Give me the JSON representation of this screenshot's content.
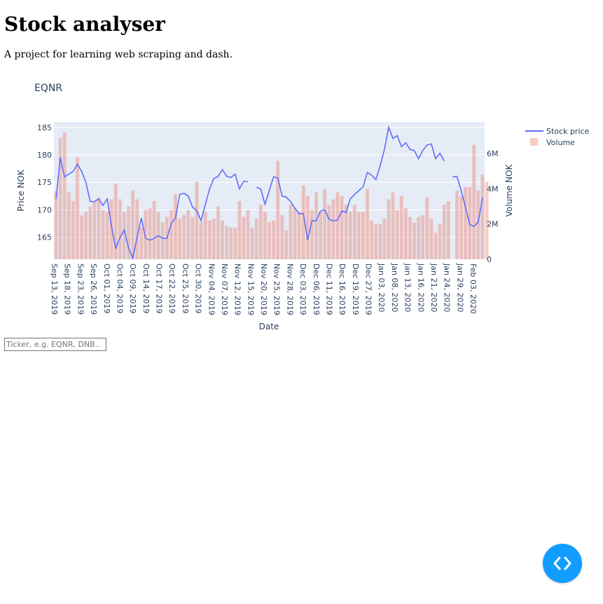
{
  "page": {
    "title": "Stock analyser",
    "subtitle": "A project for learning web scraping and dash."
  },
  "input": {
    "placeholder": "Ticker, e.g. EQNR, DNB..",
    "value": ""
  },
  "devtools": {
    "icon": "code-brackets-icon",
    "color": "#119dff"
  },
  "chart_data": {
    "type": "line",
    "title": "EQNR",
    "xlabel": "Date",
    "ylabel": "Price NOK",
    "y2label": "Volume NOK",
    "ylim": [
      161,
      186
    ],
    "y2lim": [
      0,
      7800000
    ],
    "y2ticks": [
      {
        "v": 0,
        "label": "0"
      },
      {
        "v": 2000000,
        "label": "2M"
      },
      {
        "v": 4000000,
        "label": "4M"
      },
      {
        "v": 6000000,
        "label": "6M"
      }
    ],
    "yticks": [
      165,
      170,
      175,
      180,
      185
    ],
    "background": "#e5ecf6",
    "grid": true,
    "legend": "top-right",
    "x_tick_labels": [
      "Sep 13, 2019",
      "Sep 18, 2019",
      "Sep 23, 2019",
      "Sep 26, 2019",
      "Oct 01, 2019",
      "Oct 04, 2019",
      "Oct 09, 2019",
      "Oct 14, 2019",
      "Oct 17, 2019",
      "Oct 22, 2019",
      "Oct 25, 2019",
      "Oct 30, 2019",
      "Nov 04, 2019",
      "Nov 07, 2019",
      "Nov 12, 2019",
      "Nov 15, 2019",
      "Nov 20, 2019",
      "Nov 25, 2019",
      "Nov 28, 2019",
      "Dec 03, 2019",
      "Dec 06, 2019",
      "Dec 11, 2019",
      "Dec 16, 2019",
      "Dec 19, 2019",
      "Dec 27, 2019",
      "Jan 03, 2020",
      "Jan 08, 2020",
      "Jan 13, 2020",
      "Jan 16, 2020",
      "Jan 21, 2020",
      "Jan 24, 2020",
      "Jan 29, 2020",
      "Feb 03, 2020"
    ],
    "series": [
      {
        "name": "Stock price",
        "kind": "line",
        "color": "#636efa",
        "values": [
          172,
          179.5,
          176,
          176.5,
          177,
          178.3,
          177,
          175,
          171.5,
          171.5,
          172,
          170.8,
          172,
          167,
          163,
          165,
          166.3,
          163,
          161.2,
          165,
          168.5,
          164.8,
          164.5,
          164.8,
          165.3,
          164.8,
          164.8,
          167.5,
          168.5,
          172.8,
          173,
          172.5,
          170.5,
          169.8,
          168,
          171,
          173.8,
          175.7,
          176.1,
          177.3,
          176.1,
          175.9,
          176.5,
          173.8,
          175.2,
          175.1,
          null,
          174.1,
          173.8,
          171,
          173.5,
          176,
          175.8,
          172.5,
          172.3,
          171.5,
          170.3,
          169.3,
          169.3,
          164.5,
          168,
          168,
          169.8,
          170,
          168.3,
          168,
          168.1,
          169.8,
          169.5,
          172,
          172.8,
          173.5,
          174.2,
          176.8,
          176.3,
          175.5,
          178,
          181,
          185,
          183,
          183.5,
          181.5,
          182.2,
          181,
          180.8,
          179.3,
          180.8,
          181.8,
          182,
          179.3,
          180.3,
          178.9,
          null,
          176,
          176.1,
          173.5,
          170.5,
          167.3,
          167,
          167.8,
          172.2
        ]
      },
      {
        "name": "Volume",
        "kind": "bar",
        "color": "#ef553b",
        "values": [
          3850000,
          6900000,
          7200000,
          3800000,
          3300000,
          5800000,
          2500000,
          2700000,
          3000000,
          3300000,
          3500000,
          2800000,
          2700000,
          3400000,
          4300000,
          3400000,
          2700000,
          3000000,
          3900000,
          3400000,
          1800000,
          2800000,
          2900000,
          3300000,
          2700000,
          2100000,
          2400000,
          2800000,
          3700000,
          2300000,
          2500000,
          2800000,
          2400000,
          4400000,
          2100000,
          2700000,
          2200000,
          2300000,
          3000000,
          2200000,
          1900000,
          1800000,
          1800000,
          3300000,
          2400000,
          2800000,
          1800000,
          2300000,
          3100000,
          2700000,
          2100000,
          2200000,
          5600000,
          2500000,
          1650000,
          3100000,
          2900000,
          2700000,
          4200000,
          3600000,
          2800000,
          3800000,
          2700000,
          4000000,
          3100000,
          3400000,
          3800000,
          3600000,
          3100000,
          2700000,
          3100000,
          2700000,
          2700000,
          4000000,
          2200000,
          2000000,
          2000000,
          2300000,
          3400000,
          3800000,
          2800000,
          3600000,
          2900000,
          2400000,
          2100000,
          2400000,
          2500000,
          3500000,
          2300000,
          1500000,
          2000000,
          3100000,
          3300000,
          0,
          3900000,
          3600000,
          4100000,
          4100000,
          6500000,
          3900000,
          4800000,
          4400000
        ]
      }
    ]
  }
}
